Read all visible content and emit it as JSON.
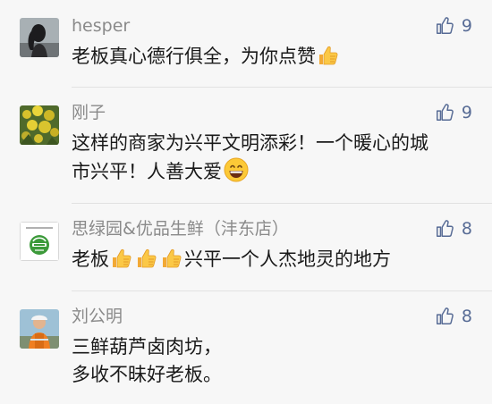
{
  "comments": [
    {
      "avatar": "woman-silhouette-avatar",
      "name": "hesper",
      "lines": [
        "老板真心德行俱全，为你点赞"
      ],
      "emoji": "thumbs-up",
      "likes": "9"
    },
    {
      "avatar": "yellow-flowers-avatar",
      "name": "刚子",
      "lines": [
        "这样的商家为兴平文明添彩！一个暖心的城",
        "市兴平！人善大爱"
      ],
      "emoji": "grinning-face",
      "likes": "9"
    },
    {
      "avatar": "green-store-logo-avatar",
      "name": "思绿园&优品生鲜（沣东店）",
      "lines_prefix": "老板",
      "lines_suffix": "兴平一个人杰地灵的地方",
      "emoji": "thumbs-up x3",
      "likes": "8"
    },
    {
      "avatar": "man-orange-vest-avatar",
      "name": "刘公明",
      "lines": [
        "三鲜葫芦卤肉坊，",
        "多收不昧好老板。"
      ],
      "likes": "8"
    }
  ],
  "colors": {
    "name": "#8a8a8a",
    "like": "#576b95",
    "text": "#1a1a1a",
    "background": "#f7f7f7"
  }
}
